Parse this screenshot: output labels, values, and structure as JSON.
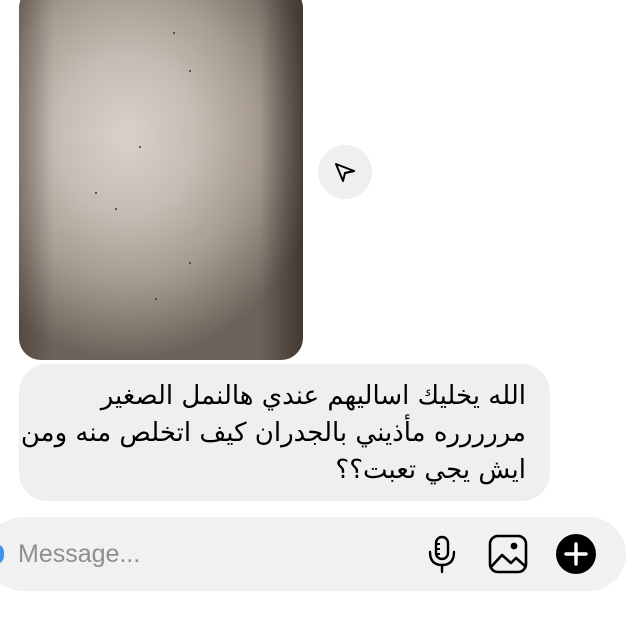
{
  "conversation": {
    "photo_message": {
      "icon": "image-attachment"
    },
    "share_button": {
      "icon": "send-arrow-icon"
    },
    "text_message": {
      "lines": [
        "الله يخليك اساليهم عندي هالنمل الصغير",
        "مررررره مأذيني بالجدران كيف اتخلص منه ومن",
        "ايش يجي تعبت؟؟"
      ]
    }
  },
  "composer": {
    "placeholder": "Message...",
    "icons": [
      "microphone-icon",
      "gallery-icon",
      "plus-icon"
    ]
  },
  "colors": {
    "bubble_background": "#efefef",
    "composer_background": "#f1f1f3",
    "placeholder_text": "#8e8e8e",
    "accent": "#3797f0"
  }
}
